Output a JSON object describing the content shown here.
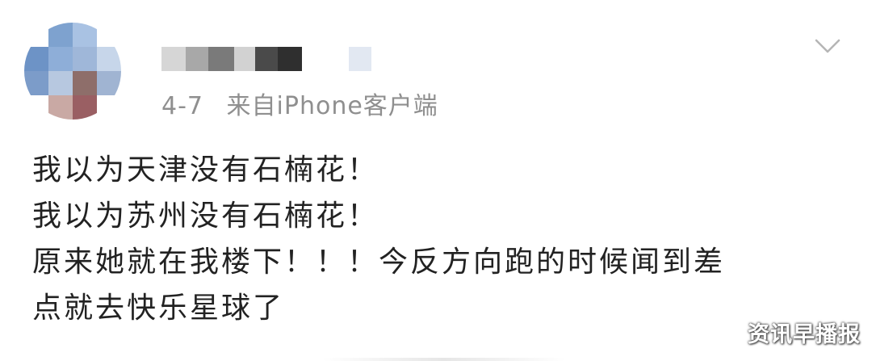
{
  "post": {
    "meta": {
      "date": "4-7",
      "source": "来自iPhone客户端"
    },
    "content": {
      "lines": [
        "我以为天津没有石楠花！",
        "我以为苏州没有石楠花！",
        "原来她就在我楼下！！！今反方向跑的时候闻到差",
        "点就去快乐星球了"
      ]
    },
    "menu_icon": "chevron-down-icon",
    "avatar_icon": "avatar-mosaic",
    "username_icon": "username-mosaic"
  },
  "watermark": {
    "text": "资讯早播报"
  },
  "colors": {
    "meta_text": "#8f8f8f",
    "content_text": "#222222",
    "chevron": "#b5b5b5",
    "mosaic": [
      "#cfcfcf",
      "#a8a8a8",
      "#6e6e6e",
      "#3f3f3f",
      "#2e2e2e",
      "#e4e4e4",
      "#dde6f2"
    ]
  }
}
